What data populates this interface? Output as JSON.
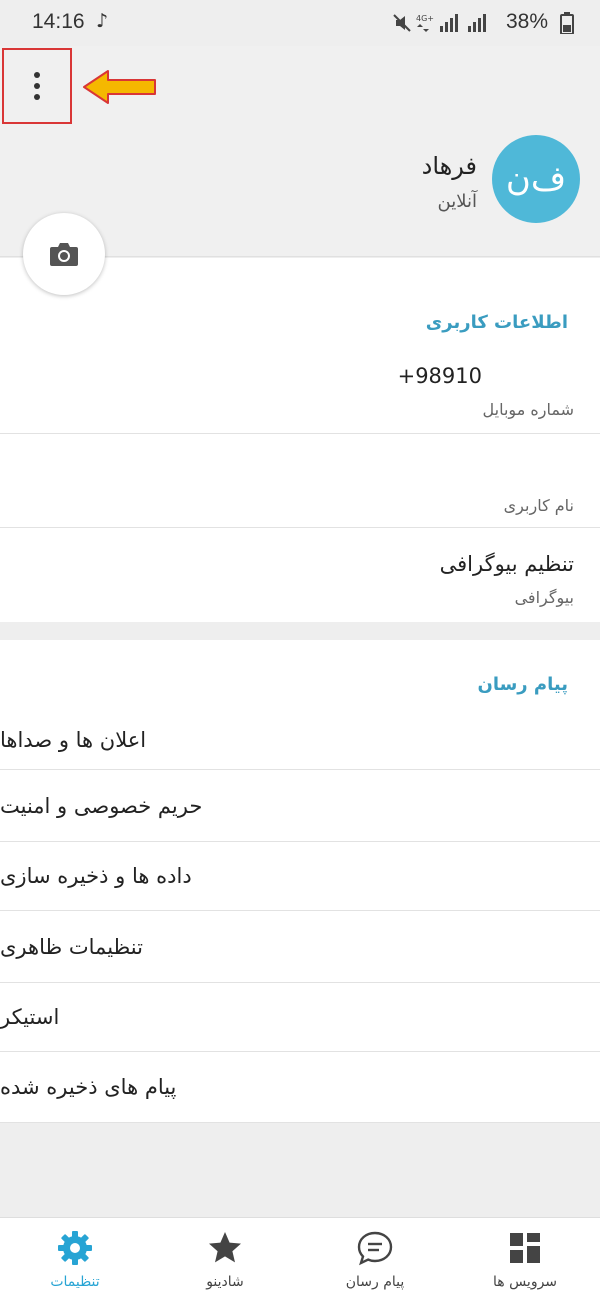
{
  "status_bar": {
    "time": "14:16",
    "network": "4G+",
    "battery": "38%"
  },
  "header": {
    "avatar_initials": "ف‌ن",
    "name": "فرهاد",
    "status": "آنلاین"
  },
  "user_info": {
    "title": "اطلاعات کاربری",
    "phone_value": "+98910",
    "phone_label": "شماره موبایل",
    "username_value": "",
    "username_label": "نام کاربری",
    "bio_value": "تنظیم بیوگرافی",
    "bio_label": "بیوگرافی"
  },
  "messenger": {
    "title": "پیام رسان",
    "items": [
      "اعلان ها و صداها",
      "حریم خصوصی و امنیت",
      "داده ها و ذخیره سازی",
      "تنظیمات ظاهری",
      "استیکر",
      "پیام های ذخیره شده"
    ]
  },
  "bottom_nav": {
    "items": [
      {
        "label": "تنظیمات",
        "icon": "gear-icon",
        "active": true
      },
      {
        "label": "شادینو",
        "icon": "star-icon",
        "active": false
      },
      {
        "label": "پیام رسان",
        "icon": "chat-icon",
        "active": false
      },
      {
        "label": "سرویس ها",
        "icon": "grid-icon",
        "active": false
      }
    ]
  },
  "colors": {
    "accent": "#3a9cc0",
    "avatar": "#4fb8d8",
    "active_nav": "#27a4d4",
    "annotation_box": "#d93636",
    "annotation_arrow": "#f5b800"
  }
}
